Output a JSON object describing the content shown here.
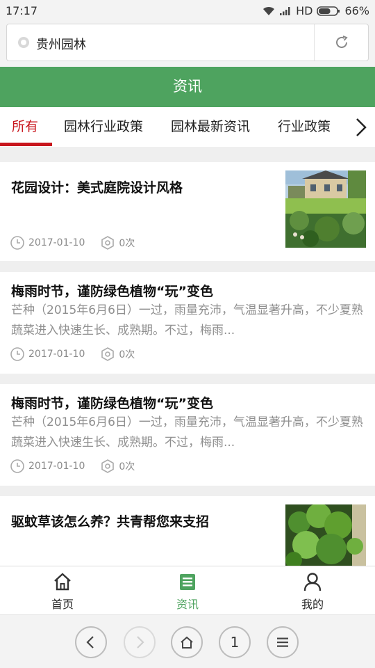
{
  "status_bar": {
    "time": "17:17",
    "network": "HD",
    "battery": "66%",
    "battery_level": 0.66
  },
  "address_bar": {
    "text": "贵州园林",
    "left_icon": "site-dot-icon",
    "reload_icon": "reload-icon"
  },
  "header": {
    "title": "资讯",
    "background": "#4ea35f"
  },
  "tabs": {
    "items": [
      {
        "label": "所有",
        "active": true
      },
      {
        "label": "园林行业政策",
        "active": false
      },
      {
        "label": "园林最新资讯",
        "active": false
      },
      {
        "label": "行业政策",
        "active": false
      }
    ],
    "next_icon": "chevron-right-icon",
    "accent": "#c8161d"
  },
  "articles": [
    {
      "title": "花园设计：美式庭院设计风格",
      "summary": "",
      "date": "2017-01-10",
      "views": "0次",
      "thumbnail": "garden-house-photo"
    },
    {
      "title": "梅雨时节，谨防绿色植物“玩”变色",
      "summary": "芒种（2015年6月6日）一过，雨量充沛，气温显著升高，不少夏熟蔬菜进入快速生长、成熟期。不过，梅雨...",
      "date": "2017-01-10",
      "views": "0次",
      "thumbnail": ""
    },
    {
      "title": "梅雨时节，谨防绿色植物“玩”变色",
      "summary": "芒种（2015年6月6日）一过，雨量充沛，气温显著升高，不少夏熟蔬菜进入快速生长、成熟期。不过，梅雨...",
      "date": "2017-01-10",
      "views": "0次",
      "thumbnail": ""
    },
    {
      "title": "驱蚊草该怎么养？共青帮您来支招",
      "summary": "",
      "date": "",
      "views": "",
      "thumbnail": "plant-photo"
    }
  ],
  "bottom_nav": [
    {
      "label": "首页",
      "icon": "home-icon",
      "active": false
    },
    {
      "label": "资讯",
      "icon": "news-icon",
      "active": true
    },
    {
      "label": "我的",
      "icon": "user-icon",
      "active": false
    }
  ],
  "browser_bar": {
    "back_icon": "back-arrow-icon",
    "forward_icon": "forward-arrow-icon",
    "home_icon": "browser-home-icon",
    "tab_count": "1",
    "menu_icon": "menu-icon"
  }
}
